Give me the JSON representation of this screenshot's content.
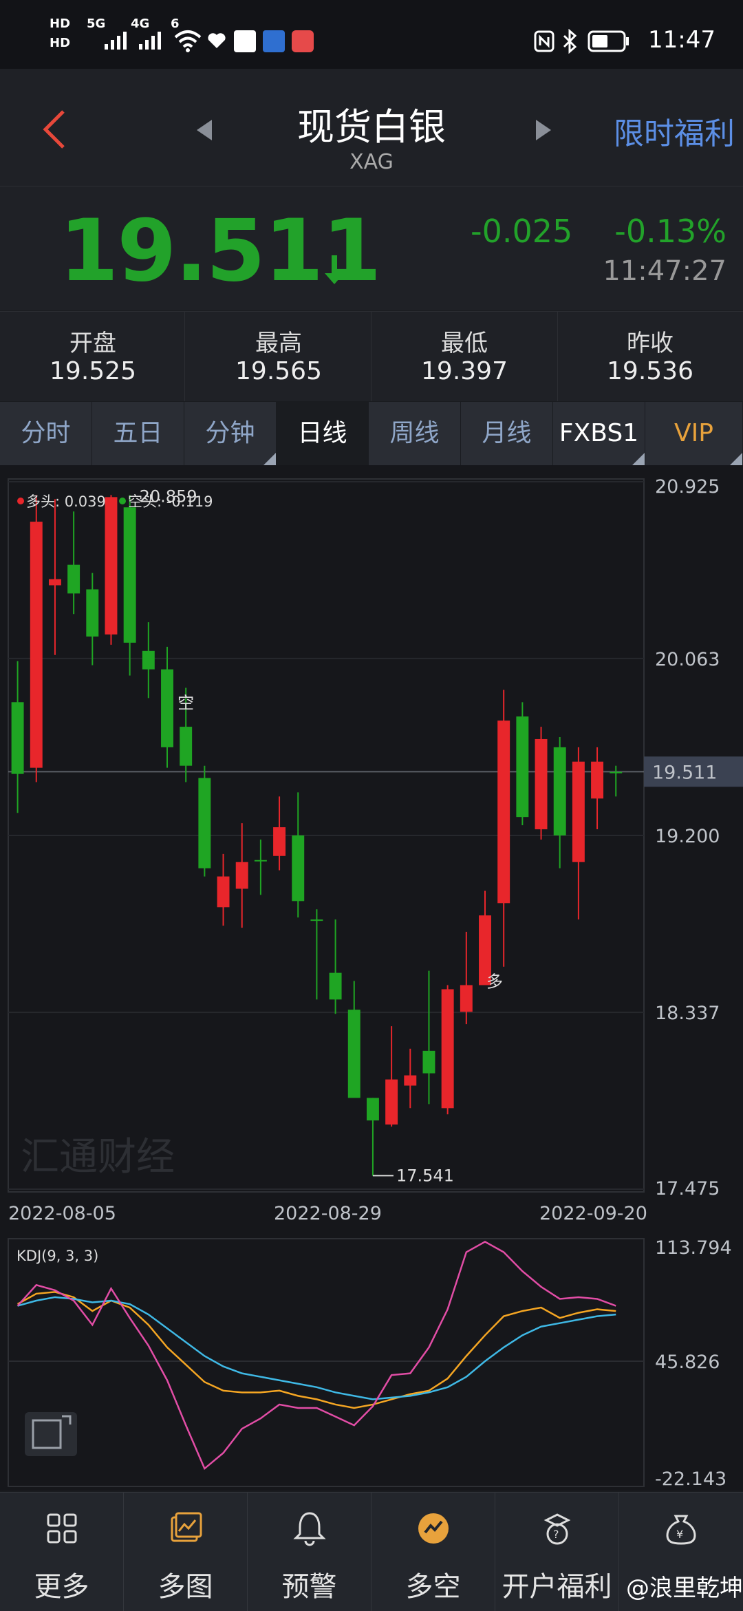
{
  "status_bar": {
    "time": "11:47",
    "signal_labels": [
      "HD",
      "5G",
      "4G",
      "6"
    ]
  },
  "header": {
    "title": "现货白银",
    "subtitle": "XAG",
    "promo": "限时福利"
  },
  "quote": {
    "price": "19.511",
    "change": "-0.025",
    "change_pct": "-0.13%",
    "time": "11:47:27",
    "color": "#22a22a"
  },
  "stats": [
    {
      "label": "开盘",
      "value": "19.525"
    },
    {
      "label": "最高",
      "value": "19.565"
    },
    {
      "label": "最低",
      "value": "19.397"
    },
    {
      "label": "昨收",
      "value": "19.536"
    }
  ],
  "tabs": [
    {
      "label": "分时"
    },
    {
      "label": "五日"
    },
    {
      "label": "分钟"
    },
    {
      "label": "日线"
    },
    {
      "label": "周线"
    },
    {
      "label": "月线"
    },
    {
      "label": "FXBS1"
    },
    {
      "label": "VIP"
    }
  ],
  "chart": {
    "legend_long": "多头: 0.039",
    "legend_short": "空头: -0.119",
    "watermark": "汇通财经",
    "kdj_label": "KDJ(9, 3, 3)",
    "kdj_axis": [
      "113.794",
      "45.826",
      "-22.143"
    ],
    "price_axis": [
      "20.925",
      "20.063",
      "19.200",
      "18.337",
      "17.475"
    ],
    "current_price_tag": "19.511",
    "dates": [
      "2022-08-05",
      "2022-08-29",
      "2022-09-20"
    ],
    "high_mark": "20.859",
    "low_mark": "17.541",
    "signal_short": "空",
    "signal_long": "多"
  },
  "chart_data": {
    "type": "candlestick",
    "ylim": [
      17.475,
      20.925
    ],
    "up_color": "#e8262b",
    "down_color": "#1fa523",
    "x": [
      "2022-08-05",
      "",
      "",
      "",
      "",
      "",
      "",
      "",
      "",
      "",
      "",
      "",
      "",
      "",
      "",
      "",
      "2022-08-29",
      "",
      "",
      "",
      "",
      "",
      "",
      "",
      "",
      "",
      "",
      "",
      "",
      "",
      "",
      "",
      "2022-09-20"
    ],
    "candles": [
      {
        "o": 19.85,
        "c": 19.5,
        "h": 20.05,
        "l": 19.31
      },
      {
        "o": 19.53,
        "c": 20.73,
        "h": 20.86,
        "l": 19.46
      },
      {
        "o": 20.42,
        "c": 20.45,
        "h": 20.84,
        "l": 20.08
      },
      {
        "o": 20.52,
        "c": 20.38,
        "h": 20.78,
        "l": 20.28
      },
      {
        "o": 20.4,
        "c": 20.17,
        "h": 20.48,
        "l": 20.03
      },
      {
        "o": 20.18,
        "c": 20.85,
        "h": 20.86,
        "l": 20.13
      },
      {
        "o": 20.8,
        "c": 20.14,
        "h": 20.86,
        "l": 19.98
      },
      {
        "o": 20.1,
        "c": 20.01,
        "h": 20.24,
        "l": 19.87
      },
      {
        "o": 20.01,
        "c": 19.63,
        "h": 20.12,
        "l": 19.53
      },
      {
        "o": 19.73,
        "c": 19.54,
        "h": 19.92,
        "l": 19.46
      },
      {
        "o": 19.48,
        "c": 19.04,
        "h": 19.54,
        "l": 19.0
      },
      {
        "o": 18.85,
        "c": 19.0,
        "h": 19.11,
        "l": 18.76
      },
      {
        "o": 18.94,
        "c": 19.07,
        "h": 19.26,
        "l": 18.75
      },
      {
        "o": 19.08,
        "c": 19.08,
        "h": 19.18,
        "l": 18.91
      },
      {
        "o": 19.1,
        "c": 19.24,
        "h": 19.39,
        "l": 19.03
      },
      {
        "o": 19.2,
        "c": 18.88,
        "h": 19.41,
        "l": 18.8
      },
      {
        "o": 18.79,
        "c": 18.79,
        "h": 18.84,
        "l": 18.4
      },
      {
        "o": 18.53,
        "c": 18.4,
        "h": 18.79,
        "l": 18.33
      },
      {
        "o": 18.35,
        "c": 17.92,
        "h": 18.49,
        "l": 17.93
      },
      {
        "o": 17.92,
        "c": 17.81,
        "h": 17.92,
        "l": 17.54
      },
      {
        "o": 17.79,
        "c": 18.01,
        "h": 18.27,
        "l": 17.78
      },
      {
        "o": 17.98,
        "c": 18.03,
        "h": 18.16,
        "l": 17.87
      },
      {
        "o": 18.15,
        "c": 18.04,
        "h": 18.54,
        "l": 17.89
      },
      {
        "o": 17.87,
        "c": 18.45,
        "h": 18.47,
        "l": 17.84
      },
      {
        "o": 18.34,
        "c": 18.47,
        "h": 18.73,
        "l": 18.28
      },
      {
        "o": 18.47,
        "c": 18.81,
        "h": 18.93,
        "l": 18.47
      },
      {
        "o": 18.87,
        "c": 19.76,
        "h": 19.91,
        "l": 18.56
      },
      {
        "o": 19.78,
        "c": 19.29,
        "h": 19.85,
        "l": 19.25
      },
      {
        "o": 19.23,
        "c": 19.67,
        "h": 19.73,
        "l": 19.18
      },
      {
        "o": 19.63,
        "c": 19.2,
        "h": 19.68,
        "l": 19.04
      },
      {
        "o": 19.07,
        "c": 19.56,
        "h": 19.63,
        "l": 18.79
      },
      {
        "o": 19.38,
        "c": 19.56,
        "h": 19.63,
        "l": 19.23
      },
      {
        "o": 19.51,
        "c": 19.51,
        "h": 19.54,
        "l": 19.39
      }
    ],
    "kdj_ylim": [
      -22.143,
      113.794
    ],
    "kdj_series": [
      {
        "name": "K",
        "color": "#f5a623",
        "values": [
          80,
          86,
          87,
          84,
          76,
          82,
          78,
          68,
          55,
          45,
          35,
          30,
          29,
          29,
          30,
          27,
          25,
          22,
          20,
          22,
          25,
          28,
          30,
          37,
          50,
          62,
          73,
          76,
          78,
          72,
          75,
          77,
          76
        ]
      },
      {
        "name": "D",
        "color": "#3fb9e6",
        "values": [
          79,
          82,
          84,
          83,
          81,
          82,
          80,
          74,
          66,
          58,
          50,
          44,
          40,
          38,
          36,
          34,
          32,
          29,
          27,
          25,
          26,
          27,
          29,
          32,
          38,
          47,
          55,
          62,
          67,
          69,
          71,
          73,
          74
        ]
      },
      {
        "name": "J",
        "color": "#e24da6",
        "values": [
          79,
          91,
          88,
          82,
          68,
          89,
          72,
          56,
          36,
          10,
          -15,
          -6,
          8,
          14,
          22,
          20,
          20,
          15,
          10,
          21,
          39,
          40,
          55,
          77,
          110,
          116,
          110,
          99,
          90,
          83,
          84,
          83,
          79
        ]
      }
    ]
  },
  "bottom_nav": [
    {
      "label": "更多",
      "icon": "grid-icon"
    },
    {
      "label": "多图",
      "icon": "multi-chart-icon"
    },
    {
      "label": "预警",
      "icon": "bell-icon"
    },
    {
      "label": "多空",
      "icon": "compass-icon"
    },
    {
      "label": "开户福利",
      "icon": "gift-icon"
    },
    {
      "label": "",
      "icon": "money-bag-icon"
    }
  ],
  "credit": "@浪里乾坤"
}
